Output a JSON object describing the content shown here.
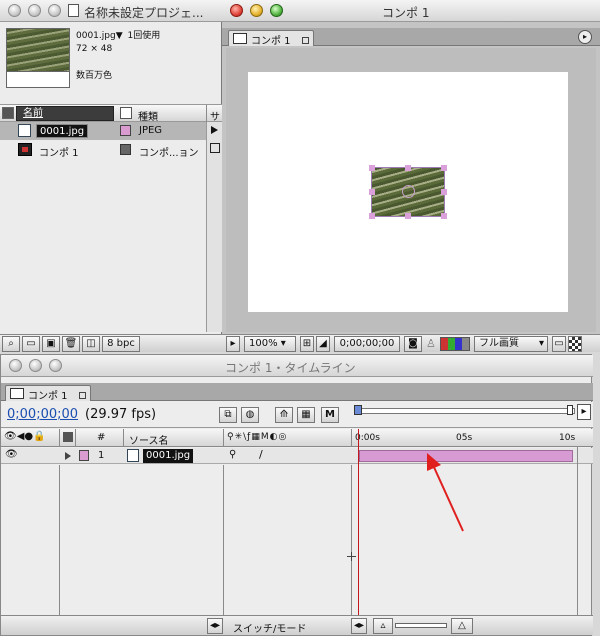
{
  "project": {
    "title": "名称未設定プロジェ...",
    "thumb_info": {
      "name": "0001.jpg▼",
      "usage": "1回使用",
      "size": "72 × 48",
      "colors": "数百万色"
    },
    "columns": {
      "name": "名前",
      "type": "種類",
      "extra": "サ"
    },
    "items": [
      {
        "name": "0001.jpg",
        "type": "JPEG",
        "color": "#d99bd0"
      },
      {
        "name": "コンポ 1",
        "type": "コンポ...ョン",
        "color": "#666666"
      }
    ],
    "bpc": "8 bpc"
  },
  "comp": {
    "title": "コンポ 1",
    "tab": "コンポ 1",
    "zoom": "100%",
    "timecode": "0;00;00;00",
    "quality": "フル画質"
  },
  "timeline": {
    "title": "コンポ 1・タイムライン",
    "tab": "コンポ 1",
    "timecode": "0;00;00;00",
    "fps": "(29.97 fps)",
    "col_hash": "#",
    "col_source": "ソース名",
    "layer": {
      "index": "1",
      "name": "0001.jpg"
    },
    "ruler": [
      "0:00s",
      "05s",
      "10s"
    ],
    "footer_mode": "スイッチ/モード"
  },
  "colors": {
    "accent_blue": "#1a4fb0",
    "layer_bar": "#d79ad2",
    "arrow": "#e0201f"
  }
}
